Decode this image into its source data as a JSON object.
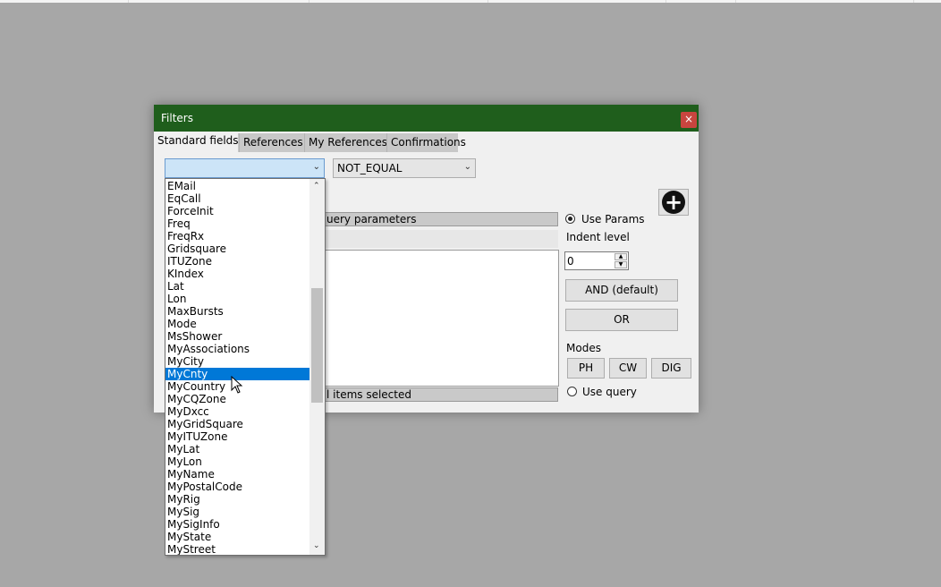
{
  "dialog": {
    "title": "Filters",
    "close_glyph": "×",
    "tabs": [
      "Standard fields",
      "References",
      "My References",
      "Confirmations"
    ],
    "active_tab": "Standard fields",
    "field_combo": {
      "value": ""
    },
    "operator_combo": {
      "value": "NOT_EQUAL"
    },
    "query_params_bar": "uery parameters",
    "items_selected_bar": "l items selected",
    "use_params": {
      "label": "Use Params",
      "checked": true
    },
    "indent_level": {
      "label": "Indent level",
      "value": "0"
    },
    "and_button": "AND (default)",
    "or_button": "OR",
    "modes": {
      "label": "Modes",
      "buttons": [
        "PH",
        "CW",
        "DIG"
      ]
    },
    "use_query": {
      "label": "Use query",
      "checked": false
    },
    "add_icon": "plus-circle-icon"
  },
  "dropdown": {
    "items": [
      "EMail",
      "EqCall",
      "ForceInit",
      "Freq",
      "FreqRx",
      "Gridsquare",
      "ITUZone",
      "KIndex",
      "Lat",
      "Lon",
      "MaxBursts",
      "Mode",
      "MsShower",
      "MyAssociations",
      "MyCity",
      "MyCnty",
      "MyCountry",
      "MyCQZone",
      "MyDxcc",
      "MyGridSquare",
      "MyITUZone",
      "MyLat",
      "MyLon",
      "MyName",
      "MyPostalCode",
      "MyRig",
      "MySig",
      "MySigInfo",
      "MyState",
      "MyStreet"
    ],
    "selected": "MyCnty"
  },
  "colors": {
    "titlebar": "#1f5e1c",
    "close": "#c8453f",
    "selection": "#0078d7",
    "background": "#a7a7a7"
  }
}
